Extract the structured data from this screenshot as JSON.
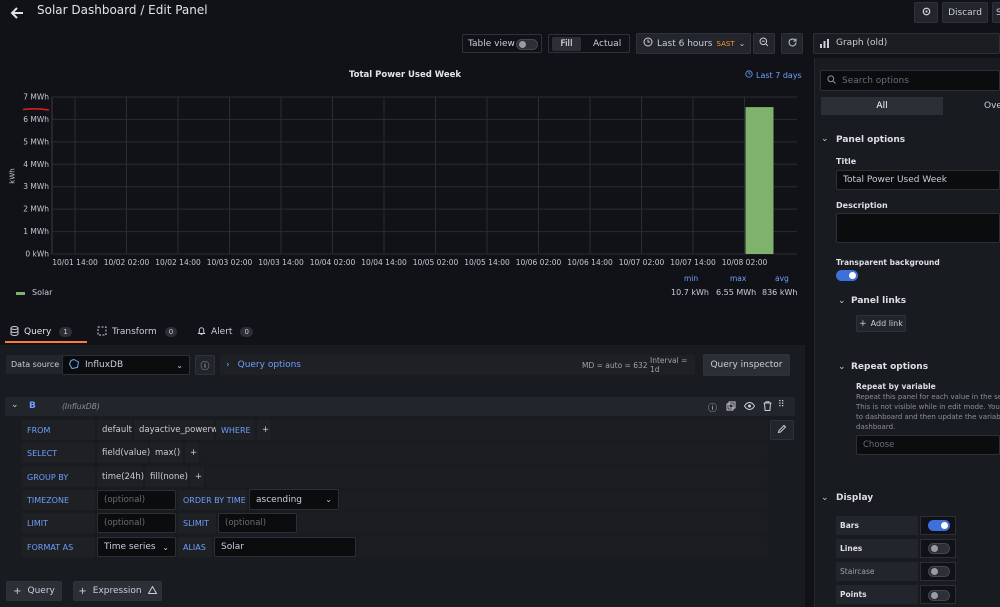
{
  "header": {
    "title": "Solar Dashboard / Edit Panel",
    "discard_label": "Discard",
    "save_label": "S"
  },
  "toolbar": {
    "table_view_label": "Table view",
    "fill_label": "Fill",
    "actual_label": "Actual",
    "time_range": "Last 6 hours",
    "timezone": "SAST",
    "viz_label": "Graph (old)"
  },
  "chart_data": {
    "type": "bar",
    "title": "Total Power Used Week",
    "time_override": "Last 7 days",
    "ylabel": "kWh",
    "ylim": [
      0,
      7
    ],
    "y_ticks": [
      "0 kWh",
      "1 MWh",
      "2 MWh",
      "3 MWh",
      "4 MWh",
      "5 MWh",
      "6 MWh",
      "7 MWh"
    ],
    "x_ticks": [
      "10/01 14:00",
      "10/02 02:00",
      "10/02 14:00",
      "10/03 02:00",
      "10/03 14:00",
      "10/04 02:00",
      "10/04 14:00",
      "10/05 02:00",
      "10/05 14:00",
      "10/06 02:00",
      "10/06 14:00",
      "10/07 02:00",
      "10/07 14:00",
      "10/08 02:00"
    ],
    "series": [
      {
        "name": "Solar",
        "color": "#7eb26d",
        "x": "10/08 02:00",
        "value_mwh": 6.55
      }
    ],
    "legend": {
      "placement": "bottom",
      "headers": [
        "min",
        "max",
        "avg"
      ],
      "rows": [
        {
          "name": "Solar",
          "min": "10.7 kWh",
          "max": "6.55 MWh",
          "avg": "836 kWh"
        }
      ]
    },
    "grid": true
  },
  "tabs": [
    {
      "label": "Query",
      "count": "1"
    },
    {
      "label": "Transform",
      "count": "0"
    },
    {
      "label": "Alert",
      "count": "0"
    }
  ],
  "datasource": {
    "label": "Data source",
    "value": "InfluxDB",
    "query_options_label": "Query options",
    "md_info": "MD = auto = 632",
    "interval_info": "Interval = 1d",
    "inspector_label": "Query inspector"
  },
  "query": {
    "ref": "B",
    "source": "(InfluxDB)",
    "from": {
      "label": "FROM",
      "policy": "default",
      "measurement": "dayactive_powerwh",
      "where": "WHERE",
      "plus": "+"
    },
    "select": {
      "label": "SELECT",
      "field": "field(value)",
      "agg": "max()",
      "plus": "+"
    },
    "group_by": {
      "label": "GROUP BY",
      "time": "time(24h)",
      "fill": "fill(none)",
      "plus": "+"
    },
    "timezone": {
      "label": "TIMEZONE",
      "placeholder": "(optional)",
      "order_label": "ORDER BY TIME",
      "order_value": "ascending"
    },
    "limit": {
      "label": "LIMIT",
      "placeholder": "(optional)",
      "slimit_label": "SLIMIT",
      "slimit_placeholder": "(optional)"
    },
    "format": {
      "label": "FORMAT AS",
      "value": "Time series",
      "alias_label": "ALIAS",
      "alias_value": "Solar"
    }
  },
  "bottom": {
    "add_query": "Query",
    "add_expression": "Expression"
  },
  "options": {
    "search_placeholder": "Search options",
    "tab_all": "All",
    "tab_overrides": "Ove",
    "panel_options": "Panel options",
    "title_label": "Title",
    "title_value": "Total Power Used Week",
    "description_label": "Description",
    "transparent_label": "Transparent background",
    "panel_links": "Panel links",
    "add_link": "Add link",
    "repeat_options": "Repeat options",
    "repeat_by": "Repeat by variable",
    "repeat_help_1": "Repeat this panel for each value in the se",
    "repeat_help_2": "This is not visible while in edit mode. You",
    "repeat_help_3": "to dashboard and then update the variab",
    "repeat_help_4": "dashboard.",
    "choose_placeholder": "Choose",
    "display": "Display",
    "bars": "Bars",
    "lines": "Lines",
    "staircase": "Staircase",
    "points": "Points"
  }
}
